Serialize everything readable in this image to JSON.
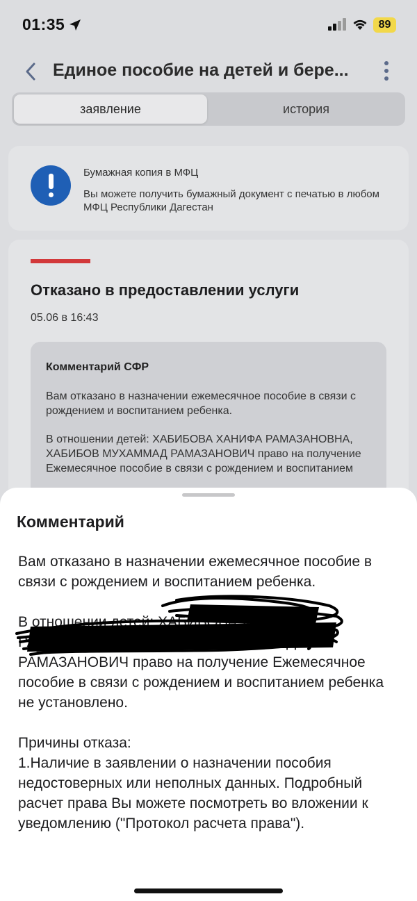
{
  "status_bar": {
    "time": "01:35",
    "battery": "89",
    "icons": [
      "location-arrow-icon",
      "cellular-signal-icon",
      "wifi-icon"
    ]
  },
  "nav": {
    "title": "Единое пособие на детей и бере..."
  },
  "tabs": [
    {
      "label": "заявление",
      "active": true
    },
    {
      "label": "история",
      "active": false
    }
  ],
  "info_card": {
    "title": "Бумажная копия в МФЦ",
    "text": "Вы можете получить бумажный документ с печатью в любом МФЦ Республики Дагестан",
    "icon": "exclamation-icon",
    "icon_color": "#1f5fb5"
  },
  "status_card": {
    "accent_color": "#d2383a",
    "title": "Отказано в предоставлении услуги",
    "date": "05.06 в 16:43",
    "comment_title": "Комментарий СФР",
    "comment_p1": "Вам отказано в назначении ежемесячное пособие в связи с рождением и воспитанием ребенка.",
    "comment_p2": "В отношении детей: ХАБИБОВА ХАНИФА РАМАЗАНОВНА, ХАБИБОВ МУХАММАД РАМАЗАНОВИЧ право на получение Ежемесячное пособие в связи с рождением и воспитанием"
  },
  "sheet": {
    "title": "Комментарий",
    "p1": "Вам отказано в назначении ежемесячное пособие в связи с рождением и воспитанием ребенка.",
    "p2": "В отношении детей: ХАБИБОВА ХАНИФА РАМАЗАНОВНА, ХАБИБОВ МУХАММАД РАМАЗАНОВИЧ право на получение Ежемесячное пособие в связи с рождением и воспитанием ребенка не установлено.",
    "p3_heading": "Причины отказа:",
    "p3_body": "1.Наличие в заявлении о назначении пособия недостоверных или неполных данных. Подробный расчет права Вы можете посмотреть во вложении к уведомлению (\"Протокол расчета права\")."
  }
}
